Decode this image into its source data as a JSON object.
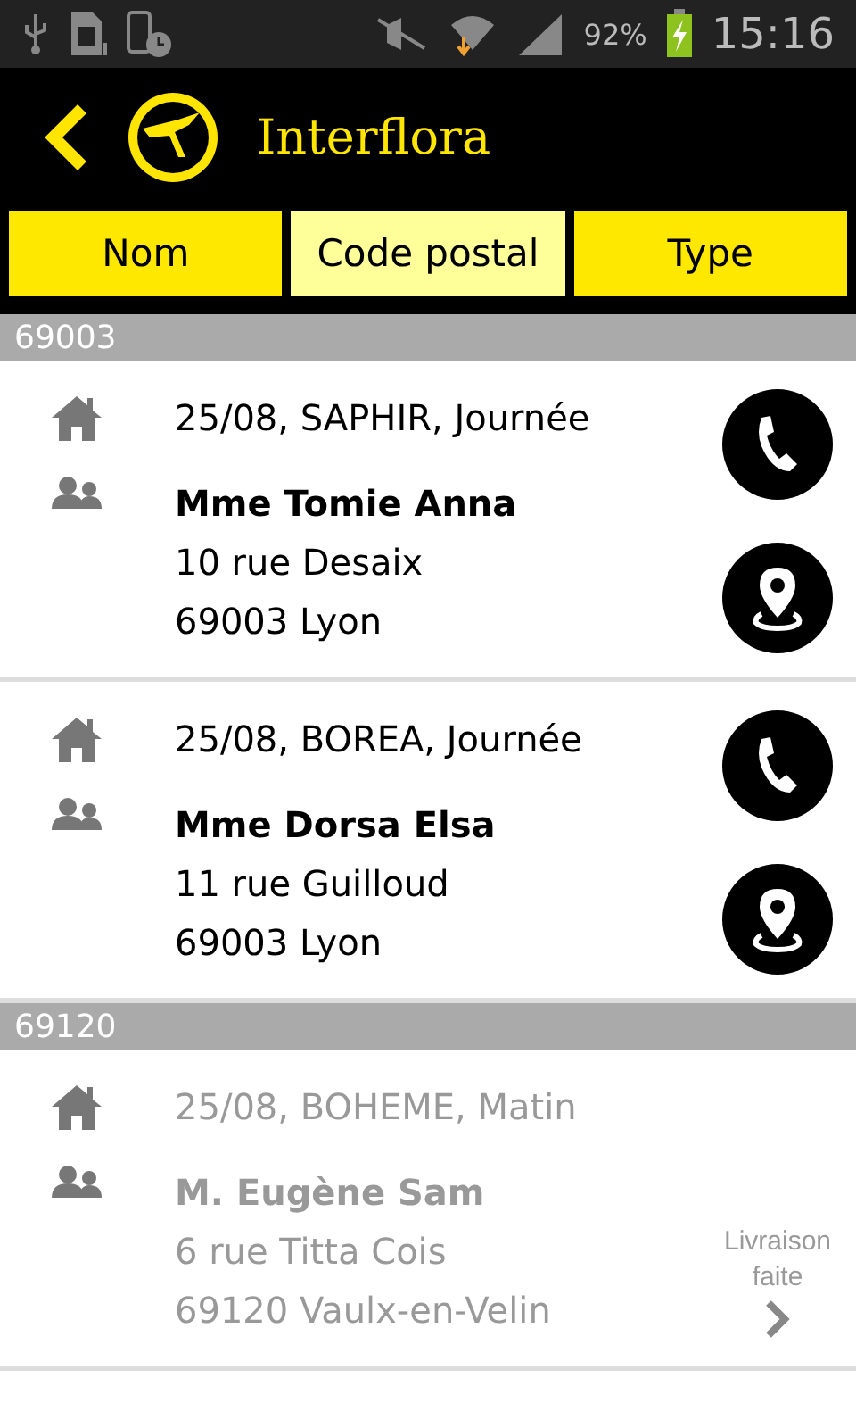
{
  "status_bar": {
    "battery": "92%",
    "time": "15:16"
  },
  "header": {
    "title": "Interflora"
  },
  "tabs": [
    {
      "label": "Nom",
      "selected": false
    },
    {
      "label": "Code postal",
      "selected": true
    },
    {
      "label": "Type",
      "selected": false
    }
  ],
  "sections": [
    {
      "title": "69003",
      "deliveries": [
        {
          "kind": "pending",
          "summary": "25/08, SAPHIR, Journée",
          "name": "Mme Tomie Anna",
          "street": "10 rue Desaix",
          "city": "69003 Lyon"
        },
        {
          "kind": "pending",
          "summary": "25/08, BOREA, Journée",
          "name": "Mme Dorsa Elsa",
          "street": "11 rue Guilloud",
          "city": "69003 Lyon"
        }
      ]
    },
    {
      "title": "69120",
      "deliveries": [
        {
          "kind": "delivered",
          "summary": "25/08, BOHEME, Matin",
          "name": "M. Eugène Sam",
          "street": "6 rue Titta Cois",
          "city": "69120 Vaulx-en-Velin",
          "status": "Livraison faite"
        }
      ]
    }
  ]
}
